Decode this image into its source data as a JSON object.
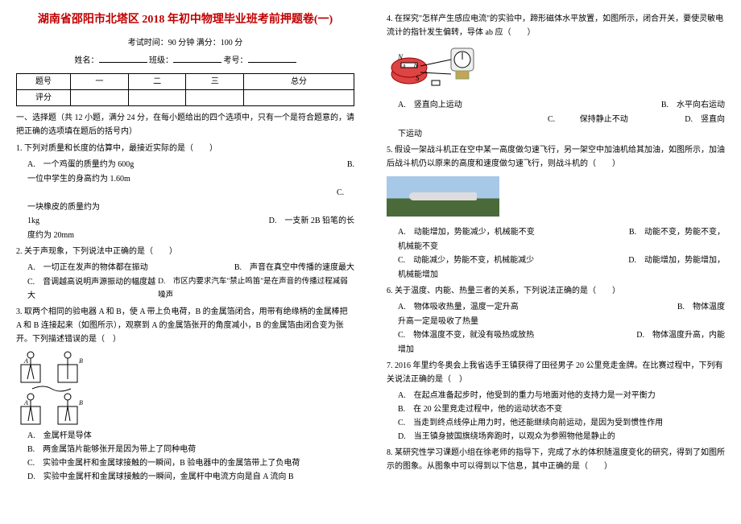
{
  "title": "湖南省邵阳市北塔区 2018 年初中物理毕业班考前押题卷(一)",
  "exam_meta": {
    "time_score": "考试时间：90 分钟  满分：100 分",
    "labels": {
      "name": "姓名：",
      "class": "班级：",
      "exam_no": "考号："
    }
  },
  "score_table": {
    "row1": [
      "题号",
      "一",
      "二",
      "三",
      "总分"
    ],
    "row2": [
      "评分",
      "",
      "",
      "",
      ""
    ]
  },
  "section1_header": "一、选择题（共 12 小题，满分 24 分，在每小题给出的四个选项中，只有一个是符合题意的，请把正确的选项填在题后的括号内）",
  "q1": {
    "stem": "1. 下列对质量和长度的估算中，最接近实际的是（　　）",
    "A": "A.　一个鸡蛋的质量约为 600g",
    "B_label": "B.",
    "B": "一位中学生的身高约为 1.60m",
    "C_label": "C.",
    "C_pre": "一块橡皮的质量约为",
    "C_val": "1kg",
    "D_label": "D.　一支新 2B 铅笔的长",
    "D_val": "度约为 20mm"
  },
  "q2": {
    "stem": "2. 关于声现象，下列说法中正确的是（　　）",
    "A": "A.　一切正在发声的物体都在振动",
    "B": "B.　声音在真空中传播的速度最大",
    "C": "C.　音调越高说明声源振动的幅度越大",
    "D": "D.　市区内要求汽车\"禁止鸣笛\"是在声音的传播过程减弱噪声"
  },
  "q3": {
    "stem": "3. 取两个相同的验电器 A 和 B，使 A 带上负电荷，B 的金属箔闭合，用带有绝缘柄的金属棒把 A 和 B 连接起来（如图所示），观察到 A 的金属箔张开的角度减小，B 的金属箔由闭合变为张开。下列描述错误的是（　）",
    "A": "A.　金属杆是导体",
    "B": "B.　两金属箔片能够张开是因为带上了同种电荷",
    "C": "C.　实验中金属杆和金属球接触的一瞬间，B 验电器中的金属箔带上了负电荷",
    "D": "D.　实验中金属杆和金属球接触的一瞬间，金属杆中电流方向是自 A 流向 B"
  },
  "q4": {
    "stem": "4. 在探究\"怎样产生感应电流\"的实验中，蹄形磁体水平放置，如图所示，闭合开关，要使灵敏电流计的指针发生偏转，导体 ab 应（　　）",
    "A": "A.　竖直向上运动",
    "B": "B.　水平向右运动",
    "C_label": "C.",
    "C": "保持静止不动",
    "D": "D.　竖直向",
    "D2": "下运动"
  },
  "q5": {
    "stem": "5. 假设一架战斗机正在空中某一高度做匀速飞行，另一架空中加油机给其加油，如图所示，加油后战斗机仍以原来的高度和速度做匀速飞行，则战斗机的（　　）",
    "A": "A.　动能增加，势能减少，机械能不变",
    "B": "B.　动能不变，势能不变，",
    "B2": "机械能不变",
    "C": "C.　动能减少，势能不变，机械能减少",
    "D": "D.　动能增加，势能增加，",
    "D2": "机械能增加"
  },
  "q6": {
    "stem": "6. 关于温度、内能、热量三者的关系，下列说法正确的是（　　）",
    "A": "A.　物体吸收热量，温度一定升高",
    "B": "B.　物体温度",
    "B2": "升高一定是吸收了热量",
    "C": "C.　物体温度不变，就没有吸热或放热",
    "D": "D.　物体温度升高，内能",
    "D2": "增加"
  },
  "q7": {
    "stem": "7. 2016 年里约冬奥会上我省选手王镇获得了田径男子 20 公里竞走金牌。在比赛过程中，下列有关说法正确的是（　）",
    "A": "A.　在起点准备起步时，他受到的重力与地面对他的支持力是一对平衡力",
    "B": "B.　在 20 公里竞走过程中，他的运动状态不变",
    "C": "C.　当走到终点线停止用力时，他还能继续向前运动，是因为受到惯性作用",
    "D": "D.　当王镇身披国旗绕场奔跑时，以观众为参照物他是静止的"
  },
  "q8": {
    "stem": "8. 某研究性学习课题小组在徐老师的指导下，完成了水的体积随温度变化的研究，得到了如图所示的图象。从图象中可以得到以下信息，其中正确的是（　　）"
  }
}
